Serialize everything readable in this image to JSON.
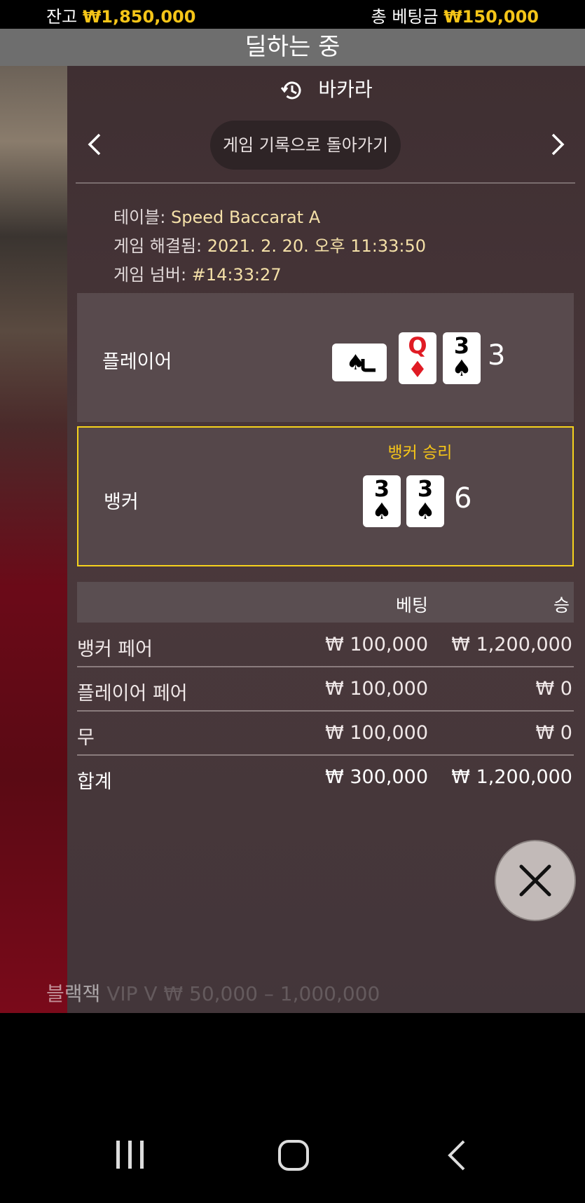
{
  "top_bar": {
    "balance_label": "잔고",
    "balance_value": "₩1,850,000",
    "total_bet_label": "총 베팅금",
    "total_bet_value": "₩150,000"
  },
  "status_banner": "딜하는 중",
  "panel": {
    "title": "바카라",
    "title_icon": "history-icon",
    "back_button": "게임 기록으로 돌아가기"
  },
  "game_info": {
    "table_label": "테이블:",
    "table_value": "Speed Baccarat A",
    "resolved_label": "게임 해결됨:",
    "resolved_value": "2021. 2. 20. 오후 11:33:50",
    "number_label": "게임 넘버:",
    "number_value": "#14:33:27"
  },
  "hands": {
    "player": {
      "label": "플레이어",
      "score": "3",
      "cards": [
        {
          "rank": "J",
          "suit": "♠",
          "color": "#000000",
          "rotated": true
        },
        {
          "rank": "Q",
          "suit": "♦",
          "color": "#e01b24",
          "rotated": false
        },
        {
          "rank": "3",
          "suit": "♠",
          "color": "#000000",
          "rotated": false
        }
      ]
    },
    "banker": {
      "label": "뱅커",
      "win_label": "뱅커 승리",
      "score": "6",
      "cards": [
        {
          "rank": "3",
          "suit": "♠",
          "color": "#000000"
        },
        {
          "rank": "3",
          "suit": "♠",
          "color": "#000000"
        }
      ]
    }
  },
  "bets_table": {
    "headers": {
      "bet": "베팅",
      "win": "승"
    },
    "rows": [
      {
        "name": "뱅커 페어",
        "bet": "₩ 100,000",
        "win": "₩ 1,200,000"
      },
      {
        "name": "플레이어 페어",
        "bet": "₩ 100,000",
        "win": "₩ 0"
      },
      {
        "name": "무",
        "bet": "₩ 100,000",
        "win": "₩ 0"
      }
    ],
    "total": {
      "name": "합계",
      "bet": "₩ 300,000",
      "win": "₩ 1,200,000"
    }
  },
  "background_text": {
    "visible": "블랙잭",
    "faded": "VIP V  ₩ 50,000 – 1,000,000"
  },
  "colors": {
    "accent_gold": "#f5c518",
    "win_border": "#f5d21c",
    "panel_bg": "#43363a"
  }
}
